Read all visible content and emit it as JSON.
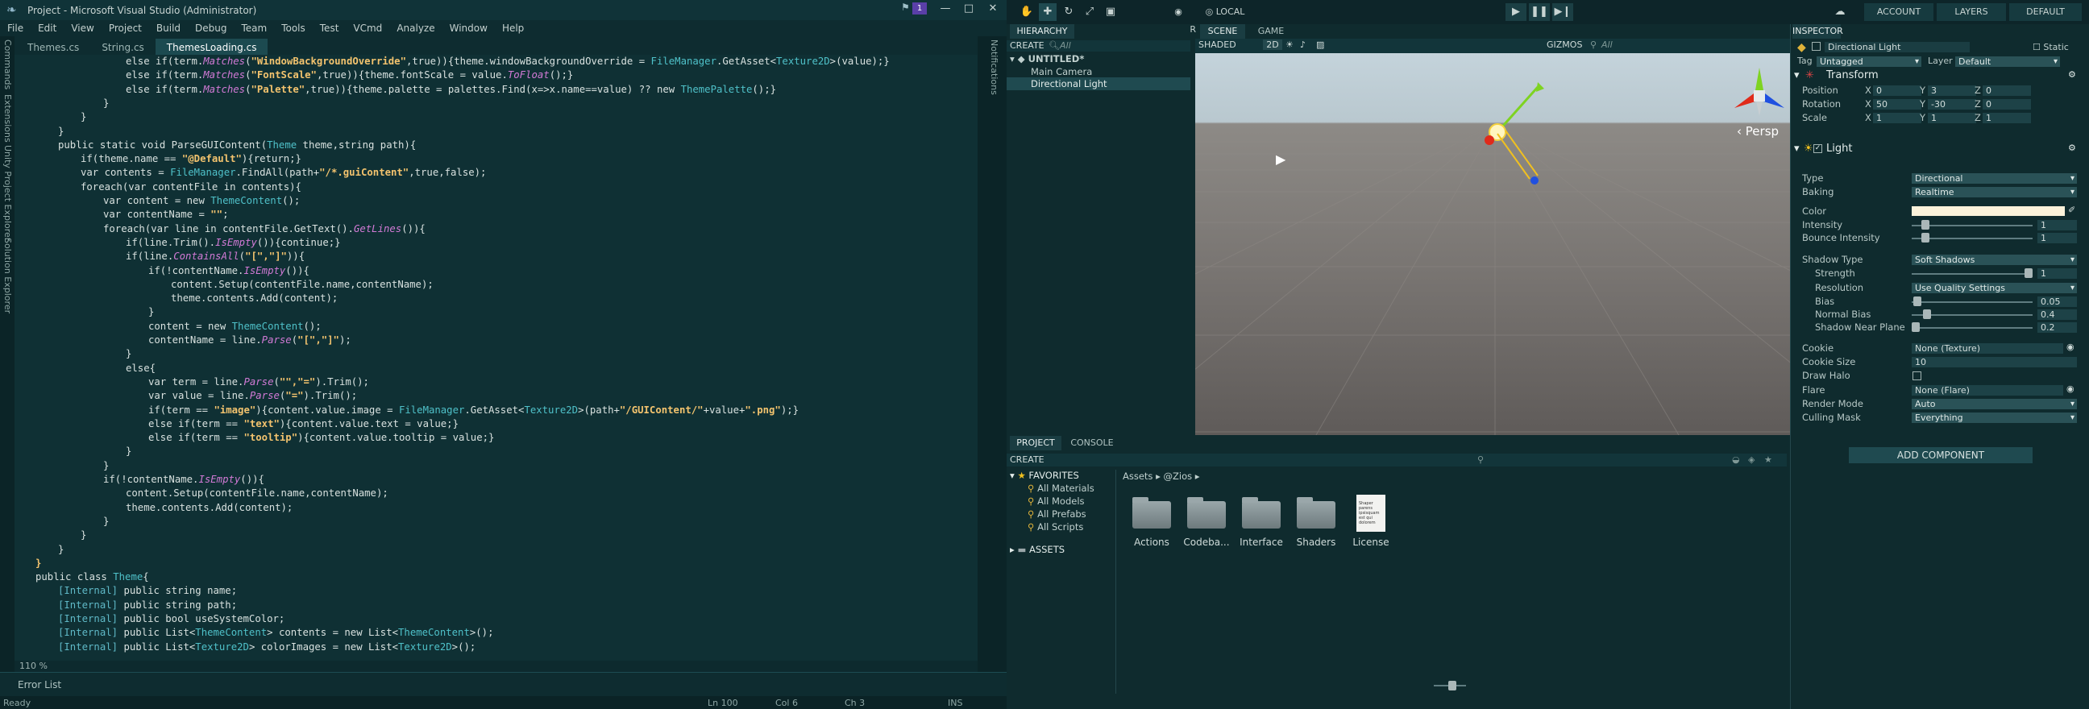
{
  "vs": {
    "title": "Project - Microsoft Visual Studio (Administrator)",
    "notif_count": "1",
    "menu": [
      "File",
      "Edit",
      "View",
      "Project",
      "Build",
      "Debug",
      "Team",
      "Tools",
      "Test",
      "VCmd",
      "Analyze",
      "Window",
      "Help"
    ],
    "tabs": [
      "Themes.cs",
      "String.cs",
      "ThemesLoading.cs"
    ],
    "left_panels": [
      "Commands",
      "Extensions",
      "Unity Project Explorer",
      "Solution Explorer"
    ],
    "right_panel": "Notifications",
    "zoom": "110 %",
    "error_list": "Error List",
    "status": {
      "ready": "Ready",
      "ln": "Ln 100",
      "col": "Col 6",
      "ch": "Ch 3",
      "mode": "INS"
    },
    "code": [
      {
        "i": 6,
        "parts": [
          [
            "k",
            "else if("
          ],
          [
            "k",
            "term."
          ],
          [
            "m",
            "Matches"
          ],
          [
            "k",
            "("
          ],
          [
            "s",
            "\"WindowBackgroundOverride\""
          ],
          [
            "k",
            ",true)){theme.windowBackgroundOverride = "
          ],
          [
            "t",
            "FileManager"
          ],
          [
            "k",
            "."
          ],
          [
            "k",
            "GetAsset<"
          ],
          [
            "t",
            "Texture2D"
          ],
          [
            "k",
            ">(value);}"
          ]
        ]
      },
      {
        "i": 6,
        "parts": [
          [
            "k",
            "else if("
          ],
          [
            "k",
            "term."
          ],
          [
            "m",
            "Matches"
          ],
          [
            "k",
            "("
          ],
          [
            "s",
            "\"FontScale\""
          ],
          [
            "k",
            ",true)){theme.fontScale = value."
          ],
          [
            "m",
            "ToFloat"
          ],
          [
            "k",
            "();}"
          ]
        ]
      },
      {
        "i": 6,
        "parts": [
          [
            "k",
            "else if("
          ],
          [
            "k",
            "term."
          ],
          [
            "m",
            "Matches"
          ],
          [
            "k",
            "("
          ],
          [
            "s",
            "\"Palette\""
          ],
          [
            "k",
            ",true)){theme.palette = palettes."
          ],
          [
            "k",
            "Find(x=>x.name==value) ?? new "
          ],
          [
            "t",
            "ThemePalette"
          ],
          [
            "k",
            "();}"
          ]
        ]
      },
      {
        "i": 5,
        "parts": [
          [
            "k",
            "}"
          ]
        ]
      },
      {
        "i": 4,
        "parts": [
          [
            "k",
            "}"
          ]
        ]
      },
      {
        "i": 3,
        "parts": [
          [
            "k",
            "}"
          ]
        ]
      },
      {
        "i": 3,
        "parts": [
          [
            "k",
            "public static void ParseGUIContent("
          ],
          [
            "t",
            "Theme"
          ],
          [
            "k",
            " theme,string path){"
          ]
        ]
      },
      {
        "i": 4,
        "parts": [
          [
            "k",
            "if(theme.name == "
          ],
          [
            "s",
            "\"@Default\""
          ],
          [
            "k",
            "){return;}"
          ]
        ]
      },
      {
        "i": 4,
        "parts": [
          [
            "k",
            "var contents = "
          ],
          [
            "t",
            "FileManager"
          ],
          [
            "k",
            ".FindAll(path+"
          ],
          [
            "s",
            "\"/*.guiContent\""
          ],
          [
            "k",
            ",true,false);"
          ]
        ]
      },
      {
        "i": 4,
        "parts": [
          [
            "k",
            "foreach(var contentFile in contents){"
          ]
        ]
      },
      {
        "i": 5,
        "parts": [
          [
            "k",
            "var content = new "
          ],
          [
            "t",
            "ThemeContent"
          ],
          [
            "k",
            "();"
          ]
        ]
      },
      {
        "i": 5,
        "parts": [
          [
            "k",
            "var contentName = "
          ],
          [
            "s",
            "\"\""
          ],
          [
            "k",
            ";"
          ]
        ]
      },
      {
        "i": 5,
        "parts": [
          [
            "k",
            "foreach(var line in contentFile."
          ],
          [
            "k",
            "GetText()."
          ],
          [
            "m",
            "GetLines"
          ],
          [
            "k",
            "()){"
          ]
        ]
      },
      {
        "i": 6,
        "parts": [
          [
            "k",
            "if(line."
          ],
          [
            "k",
            "Trim()."
          ],
          [
            "m",
            "IsEmpty"
          ],
          [
            "k",
            "()){continue;}"
          ]
        ]
      },
      {
        "i": 6,
        "parts": [
          [
            "k",
            "if(line."
          ],
          [
            "m",
            "ContainsAll"
          ],
          [
            "k",
            "("
          ],
          [
            "s",
            "\"[\",\"]\""
          ],
          [
            "k",
            "))"
          ],
          [
            "k",
            "{"
          ]
        ]
      },
      {
        "i": 7,
        "parts": [
          [
            "k",
            "if(!contentName."
          ],
          [
            "m",
            "IsEmpty"
          ],
          [
            "k",
            "()){"
          ]
        ]
      },
      {
        "i": 8,
        "parts": [
          [
            "k",
            "content."
          ],
          [
            "k",
            "Setup(contentFile.name,contentName);"
          ]
        ]
      },
      {
        "i": 8,
        "parts": [
          [
            "k",
            "theme.contents."
          ],
          [
            "k",
            "Add(content);"
          ]
        ]
      },
      {
        "i": 7,
        "parts": [
          [
            "k",
            "}"
          ]
        ]
      },
      {
        "i": 7,
        "parts": [
          [
            "k",
            "content = new "
          ],
          [
            "t",
            "ThemeContent"
          ],
          [
            "k",
            "();"
          ]
        ]
      },
      {
        "i": 7,
        "parts": [
          [
            "k",
            "contentName = line."
          ],
          [
            "m",
            "Parse"
          ],
          [
            "k",
            "("
          ],
          [
            "s",
            "\"[\",\"]\""
          ],
          [
            "k",
            ");"
          ]
        ]
      },
      {
        "i": 6,
        "parts": [
          [
            "k",
            "}"
          ]
        ]
      },
      {
        "i": 6,
        "parts": [
          [
            "k",
            "else{"
          ]
        ]
      },
      {
        "i": 7,
        "parts": [
          [
            "k",
            "var term = line."
          ],
          [
            "m",
            "Parse"
          ],
          [
            "k",
            "("
          ],
          [
            "s",
            "\"\",\"=\""
          ],
          [
            "k",
            ").Trim();"
          ]
        ]
      },
      {
        "i": 7,
        "parts": [
          [
            "k",
            "var value = line."
          ],
          [
            "m",
            "Parse"
          ],
          [
            "k",
            "("
          ],
          [
            "s",
            "\"=\""
          ],
          [
            "k",
            ").Trim();"
          ]
        ]
      },
      {
        "i": 7,
        "parts": [
          [
            "k",
            "if(term == "
          ],
          [
            "s",
            "\"image\""
          ],
          [
            "k",
            "){content.value.image = "
          ],
          [
            "t",
            "FileManager"
          ],
          [
            "k",
            ".GetAsset<"
          ],
          [
            "t",
            "Texture2D"
          ],
          [
            "k",
            ">(path+"
          ],
          [
            "s",
            "\"/GUIContent/\""
          ],
          [
            "k",
            "+value+"
          ],
          [
            "s",
            "\".png\""
          ],
          [
            "k",
            ");}"
          ]
        ]
      },
      {
        "i": 7,
        "parts": [
          [
            "k",
            "else if(term == "
          ],
          [
            "s",
            "\"text\""
          ],
          [
            "k",
            "){content.value.text = value;}"
          ]
        ]
      },
      {
        "i": 7,
        "parts": [
          [
            "k",
            "else if(term == "
          ],
          [
            "s",
            "\"tooltip\""
          ],
          [
            "k",
            "){content.value.tooltip = value;}"
          ]
        ]
      },
      {
        "i": 6,
        "parts": [
          [
            "k",
            "}"
          ]
        ]
      },
      {
        "i": 5,
        "parts": [
          [
            "k",
            "}"
          ]
        ]
      },
      {
        "i": 5,
        "parts": [
          [
            "k",
            "if(!contentName."
          ],
          [
            "m",
            "IsEmpty"
          ],
          [
            "k",
            "()){"
          ]
        ]
      },
      {
        "i": 6,
        "parts": [
          [
            "k",
            "content."
          ],
          [
            "k",
            "Setup(contentFile.name,contentName);"
          ]
        ]
      },
      {
        "i": 6,
        "parts": [
          [
            "k",
            "theme.contents."
          ],
          [
            "k",
            "Add(content);"
          ]
        ]
      },
      {
        "i": 5,
        "parts": [
          [
            "k",
            "}"
          ]
        ]
      },
      {
        "i": 4,
        "parts": [
          [
            "k",
            "}"
          ]
        ]
      },
      {
        "i": 3,
        "parts": [
          [
            "k",
            "}"
          ]
        ]
      },
      {
        "i": 2,
        "parts": [
          [
            "s",
            "}"
          ]
        ]
      },
      {
        "i": 2,
        "parts": [
          [
            "k",
            "public class "
          ],
          [
            "t",
            "Theme"
          ],
          [
            "k",
            "{"
          ]
        ]
      },
      {
        "i": 3,
        "parts": [
          [
            "a",
            "[Internal]"
          ],
          [
            "k",
            " public string name;"
          ]
        ]
      },
      {
        "i": 3,
        "parts": [
          [
            "a",
            "[Internal]"
          ],
          [
            "k",
            " public string path;"
          ]
        ]
      },
      {
        "i": 3,
        "parts": [
          [
            "a",
            "[Internal]"
          ],
          [
            "k",
            " public bool useSystemColor;"
          ]
        ]
      },
      {
        "i": 3,
        "parts": [
          [
            "a",
            "[Internal]"
          ],
          [
            "k",
            " public List<"
          ],
          [
            "t",
            "ThemeContent"
          ],
          [
            "k",
            "> contents = new List<"
          ],
          [
            "t",
            "ThemeContent"
          ],
          [
            "k",
            ">();"
          ]
        ]
      },
      {
        "i": 3,
        "parts": [
          [
            "a",
            "[Internal]"
          ],
          [
            "k",
            " public List<"
          ],
          [
            "t",
            "Texture2D"
          ],
          [
            "k",
            "> colorImages = new List<"
          ],
          [
            "t",
            "Texture2D"
          ],
          [
            "k",
            ">();"
          ]
        ]
      }
    ]
  },
  "unity": {
    "toolbar": {
      "center": "CENTER",
      "local": "LOCAL",
      "account": "ACCOUNT",
      "layers": "LAYERS",
      "layout": "DEFAULT"
    },
    "hierarchy": {
      "tab": "HIERARCHY",
      "create": "CREATE",
      "search": "All",
      "scene": "UNTITLED*",
      "items": [
        "Main Camera",
        "Directional Light"
      ]
    },
    "scene": {
      "tab_scene": "SCENE",
      "tab_game": "GAME",
      "shaded": "SHADED",
      "mode2d": "2D",
      "gizmos": "GIZMOS",
      "search": "All",
      "persp": "Persp"
    },
    "project": {
      "tab_project": "PROJECT",
      "tab_console": "CONSOLE",
      "create": "CREATE",
      "favorites": "FAVORITES",
      "fav_items": [
        "All Materials",
        "All Models",
        "All Prefabs",
        "All Scripts"
      ],
      "assets": "ASSETS",
      "breadcrumb_root": "Assets",
      "breadcrumb_folder": "@Zios",
      "folders": [
        "Actions",
        "Codeba...",
        "Interface",
        "Shaders"
      ],
      "file": "License",
      "file_thumb": "Shaper parens ipsisquam est qui dolorem"
    },
    "inspector": {
      "tab": "INSPECTOR",
      "object_name": "Directional Light",
      "static": "Static",
      "tag_label": "Tag",
      "tag": "Untagged",
      "layer_label": "Layer",
      "layer": "Default",
      "transform": {
        "title": "Transform",
        "position_label": "Position",
        "rotation_label": "Rotation",
        "scale_label": "Scale",
        "position": [
          "0",
          "3",
          "0"
        ],
        "rotation": [
          "50",
          "-30",
          "0"
        ],
        "scale": [
          "1",
          "1",
          "1"
        ]
      },
      "light": {
        "title": "Light",
        "type_label": "Type",
        "type": "Directional",
        "baking_label": "Baking",
        "baking": "Realtime",
        "color_label": "Color",
        "color": "#fbf2da",
        "intensity_label": "Intensity",
        "intensity": "1",
        "bounce_label": "Bounce Intensity",
        "bounce": "1",
        "shadow_label": "Shadow Type",
        "shadow": "Soft Shadows",
        "strength_label": "Strength",
        "strength": "1",
        "resolution_label": "Resolution",
        "resolution": "Use Quality Settings",
        "bias_label": "Bias",
        "bias": "0.05",
        "normal_bias_label": "Normal Bias",
        "normal_bias": "0.4",
        "near_plane_label": "Shadow Near Plane",
        "near_plane": "0.2",
        "cookie_label": "Cookie",
        "cookie": "None (Texture)",
        "cookie_size_label": "Cookie Size",
        "cookie_size": "10",
        "halo_label": "Draw Halo",
        "flare_label": "Flare",
        "flare": "None (Flare)",
        "render_label": "Render Mode",
        "render": "Auto",
        "mask_label": "Culling Mask",
        "mask": "Everything"
      },
      "add_component": "ADD COMPONENT"
    }
  }
}
